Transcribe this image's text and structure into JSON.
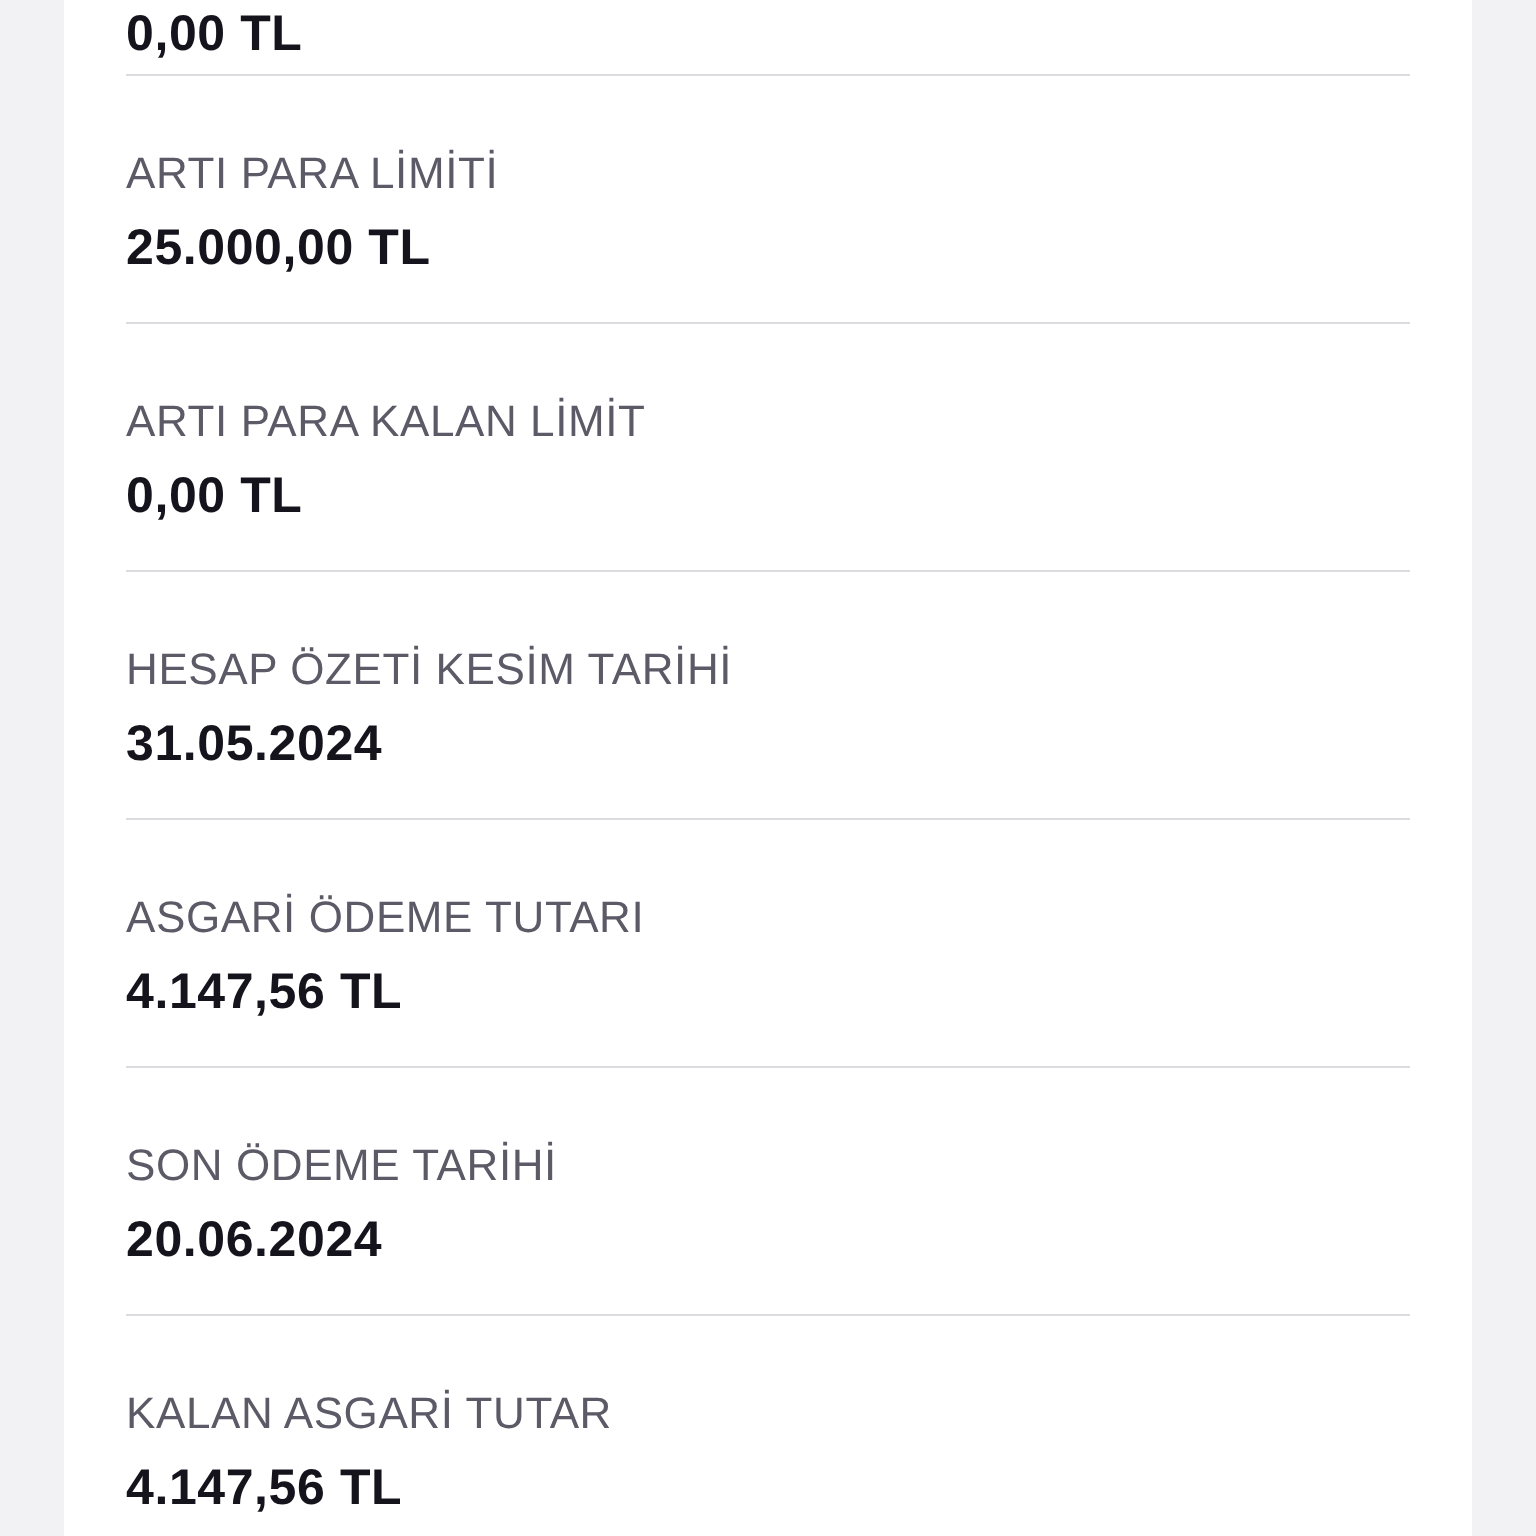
{
  "details": [
    {
      "value": "0,00 TL"
    },
    {
      "label": "ARTI PARA LİMİTİ",
      "value": "25.000,00 TL"
    },
    {
      "label": "ARTI PARA KALAN LİMİT",
      "value": "0,00 TL"
    },
    {
      "label": "HESAP ÖZETİ KESİM TARİHİ",
      "value": "31.05.2024"
    },
    {
      "label": "ASGARİ ÖDEME TUTARI",
      "value": "4.147,56 TL"
    },
    {
      "label": "SON ÖDEME TARİHİ",
      "value": "20.06.2024"
    },
    {
      "label": "KALAN ASGARİ TUTAR",
      "value": "4.147,56 TL"
    }
  ]
}
